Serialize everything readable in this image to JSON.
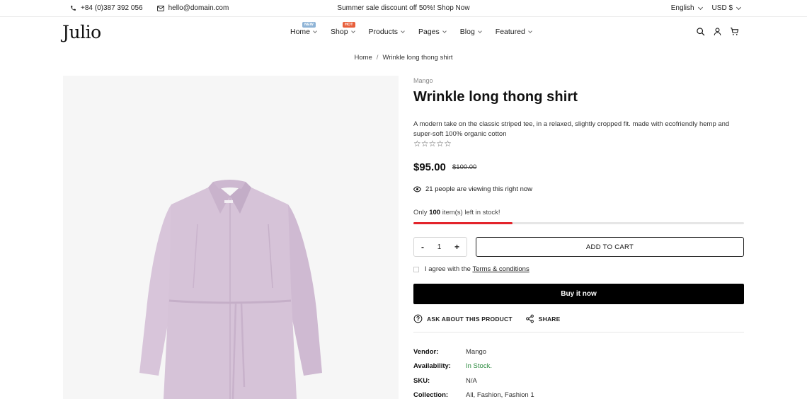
{
  "topbar": {
    "phone": "+84 (0)387 392 056",
    "email": "hello@domain.com",
    "promo": "Summer sale discount off 50%! Shop Now",
    "language": "English",
    "currency": "USD $"
  },
  "header": {
    "logo": "Julio",
    "nav": [
      {
        "label": "Home",
        "badge": "NEW"
      },
      {
        "label": "Shop",
        "badge": "HOT"
      },
      {
        "label": "Products",
        "badge": ""
      },
      {
        "label": "Pages",
        "badge": ""
      },
      {
        "label": "Blog",
        "badge": ""
      },
      {
        "label": "Featured",
        "badge": ""
      }
    ],
    "icons": [
      "search-icon",
      "user-icon",
      "cart-icon"
    ]
  },
  "breadcrumb": {
    "home": "Home",
    "separator": "/",
    "current": "Wrinkle long thong shirt"
  },
  "product": {
    "vendor_label_top": "Mango",
    "title": "Wrinkle long thong shirt",
    "description": "A modern take on the classic striped tee, in a relaxed, slightly cropped fit. made with ecofriendly hemp and super-soft 100% organic cotton",
    "rating": 0,
    "rating_max": 5,
    "price": "$95.00",
    "compare_price": "$100.00",
    "viewing_text": "21 people are viewing this right now",
    "stock_prefix": "Only",
    "stock_count": "100",
    "stock_suffix": "item(s) left in stock!",
    "stock_fraction": 0.3,
    "quantity": "1",
    "minus_label": "-",
    "plus_label": "+",
    "add_to_cart": "ADD TO CART",
    "agree_text": "I agree with the",
    "terms_link": "Terms & conditions",
    "buy_now": "Buy it now",
    "ask_label": "ASK ABOUT THIS PRODUCT",
    "share_label": "SHARE",
    "meta": [
      {
        "key": "Vendor:",
        "value": "Mango"
      },
      {
        "key": "Availability:",
        "value": "In Stock."
      },
      {
        "key": "SKU:",
        "value": "N/A"
      },
      {
        "key": "Collection:",
        "value": "All, Fashion, Fashion 1"
      }
    ]
  },
  "colors": {
    "accent_red": "#e3242b",
    "in_stock_green": "#2b8a3e",
    "garment_lilac": "#d6c3d8"
  }
}
